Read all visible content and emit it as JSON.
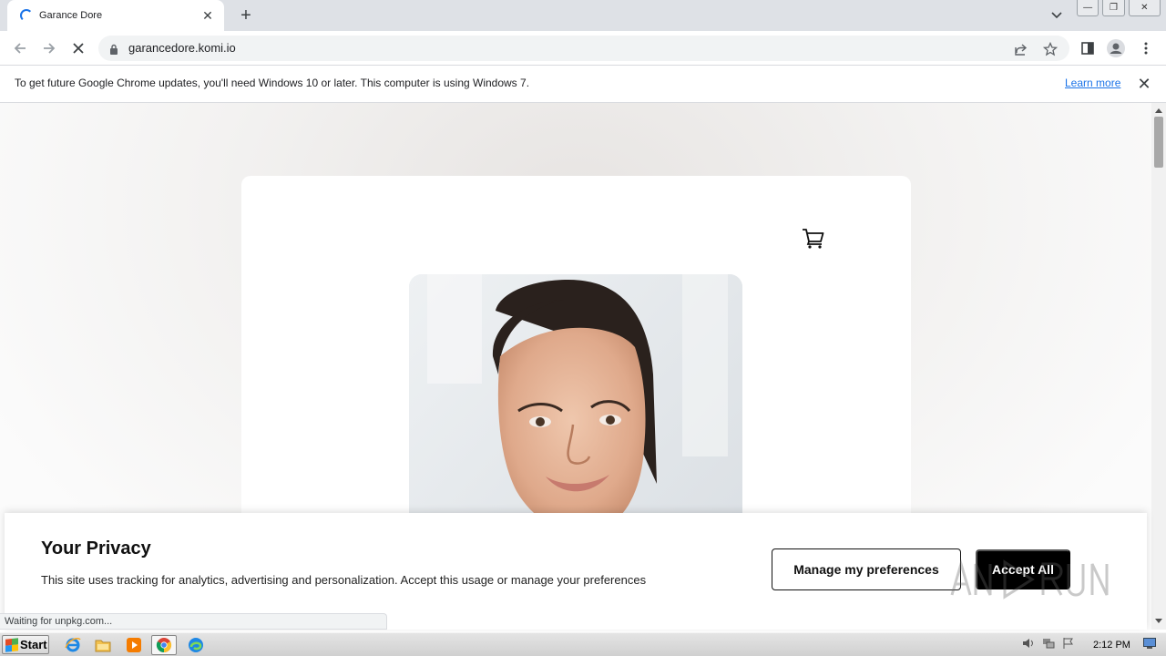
{
  "browser": {
    "tab_title": "Garance Dore",
    "tab_close_icon": "close-icon",
    "new_tab_icon": "plus-icon",
    "url": "garancedore.komi.io",
    "minimize_label": "—",
    "maximize_label": "❐",
    "close_label": "✕"
  },
  "infobar": {
    "message": "To get future Google Chrome updates, you'll need Windows 10 or later. This computer is using Windows 7.",
    "learn_more": "Learn more",
    "close_label": "✕"
  },
  "privacy": {
    "title": "Your Privacy",
    "text": "This site uses tracking for analytics, advertising and personalization. Accept this usage or manage your preferences",
    "manage_label": "Manage my preferences",
    "accept_label": "Accept All"
  },
  "status_bubble": "Waiting for unpkg.com...",
  "taskbar": {
    "start_label": "Start",
    "clock": "2:12 PM"
  },
  "colors": {
    "accent_blue": "#1a73e8",
    "accept_button_bg": "#000000"
  }
}
